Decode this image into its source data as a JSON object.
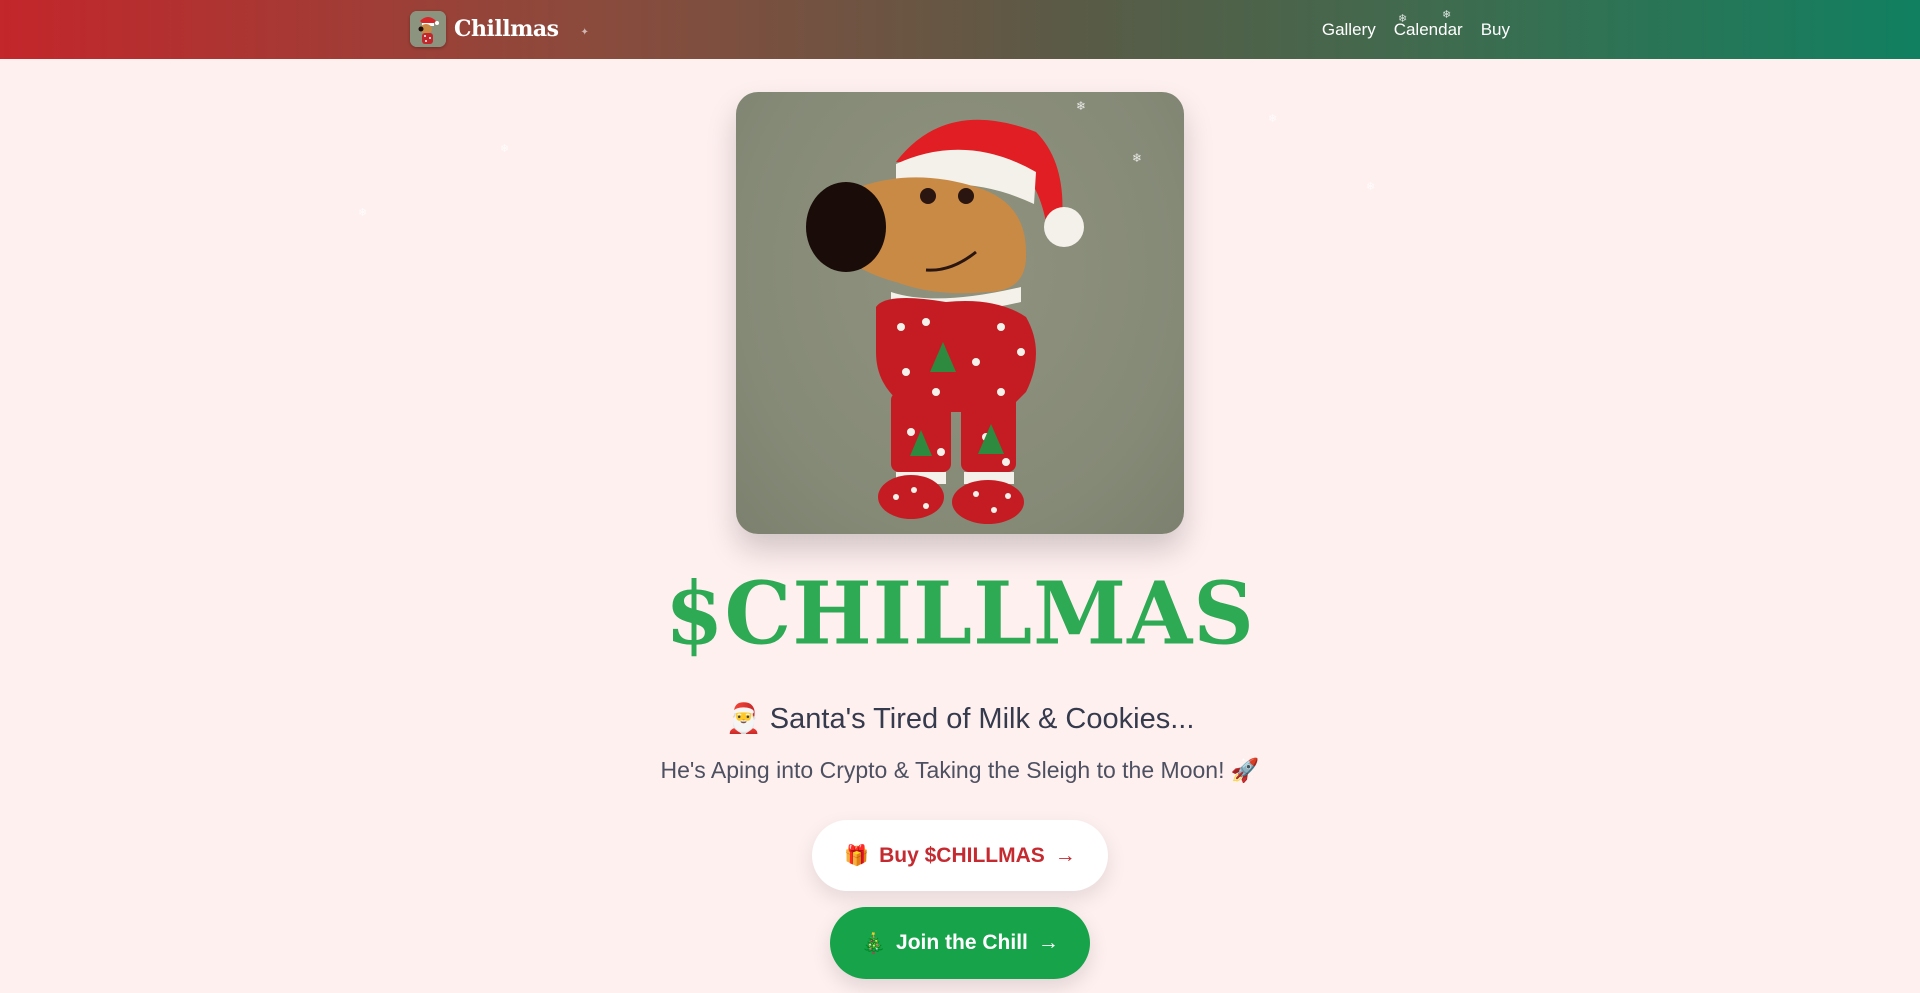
{
  "header": {
    "brand_name": "Chillmas",
    "brand_glyph": "✦",
    "nav": [
      {
        "label": "Gallery"
      },
      {
        "label": "Calendar"
      },
      {
        "label": "Buy"
      }
    ]
  },
  "hero": {
    "image_icon": "dog-in-santa-pajamas-illustration",
    "title": "$CHILLMAS",
    "subtitle": "Santa's Tired of Milk & Cookies...",
    "subtitle_glyph": "🎅",
    "tagline": "He's Aping into Crypto & Taking the Sleigh to the Moon!",
    "tagline_glyph": "🚀"
  },
  "actions": {
    "buy_label": "Buy $CHILLMAS",
    "buy_glyph": "🎁",
    "buy_arrow": "→",
    "join_label": "Join the Chill",
    "join_glyph": "🎄",
    "join_arrow": "→"
  },
  "colors": {
    "header_start": "#c3262b",
    "header_end": "#108060",
    "title_green": "#2eaa55",
    "buy_red": "#c42a30",
    "join_green": "#16a34a",
    "page_bg": "#fff0f0"
  }
}
